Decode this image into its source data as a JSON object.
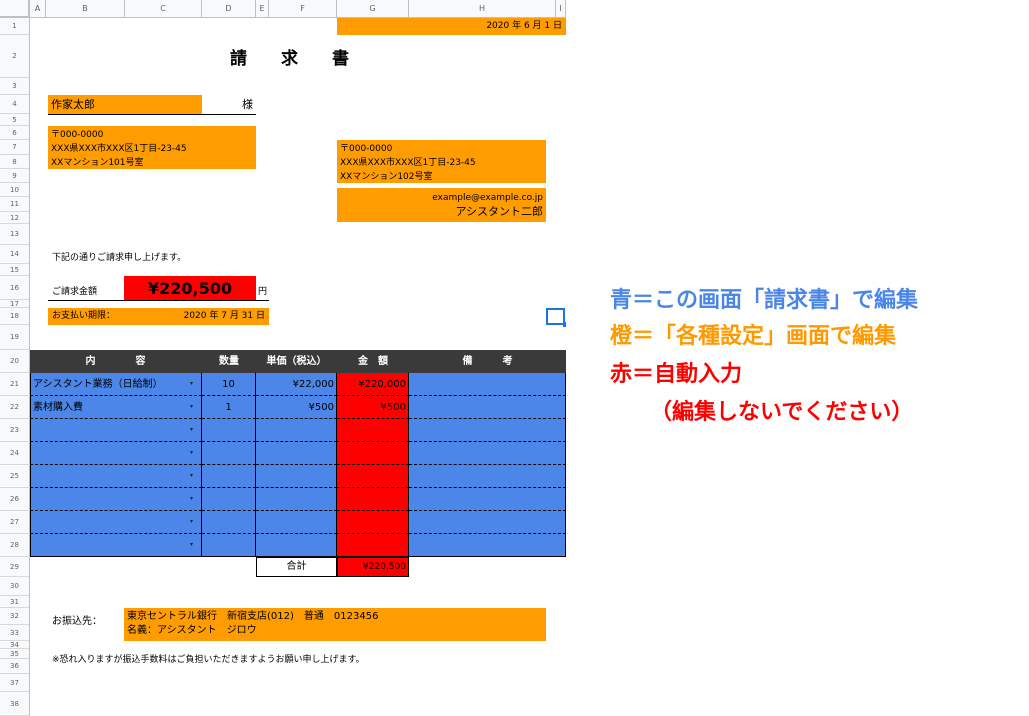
{
  "columns": [
    "A",
    "B",
    "C",
    "D",
    "E",
    "F",
    "G",
    "H",
    "I"
  ],
  "rows": [
    "1",
    "2",
    "3",
    "4",
    "5",
    "6",
    "7",
    "8",
    "9",
    "10",
    "11",
    "12",
    "13",
    "14",
    "15",
    "16",
    "17",
    "18",
    "19",
    "20",
    "21",
    "22",
    "23",
    "24",
    "25",
    "26",
    "27",
    "28",
    "29",
    "30",
    "31",
    "32",
    "33",
    "34",
    "35",
    "36",
    "37",
    "38"
  ],
  "date": "2020 年 6 月 1 日",
  "title": "請　　求　　書",
  "client": {
    "name": "作家太郎",
    "honorific": "様",
    "address": [
      "〒000-0000",
      "XXX県XXX市XXX区1丁目-23-45",
      "XXマンション101号室"
    ]
  },
  "sender": {
    "address": [
      "〒000-0000",
      "XXX県XXX市XXX区1丁目-23-45",
      "XXマンション102号室"
    ],
    "email": "example@example.co.jp",
    "name": "アシスタント二郎"
  },
  "intro": "下記の通りご請求申し上げます。",
  "amount_label": "ご請求金額",
  "amount": "¥220,500",
  "yen": "円",
  "due_label": "お支払い期限：",
  "due_date": "2020 年 7 月 31 日",
  "table": {
    "headers": [
      "内　　　　容",
      "数量",
      "単価（税込）",
      "金　額",
      "備　　　考"
    ],
    "items": [
      {
        "desc": "アシスタント業務（日給制）",
        "qty": "10",
        "price": "¥22,000",
        "amount": "¥220,000"
      },
      {
        "desc": "素材購入費",
        "qty": "1",
        "price": "¥500",
        "amount": "¥500"
      }
    ],
    "dropdown_symbol": "▾",
    "total_label": "合計",
    "total": "¥220,500"
  },
  "bank": {
    "label": "お振込先：",
    "line1": "東京セントラル銀行　新宿支店(012)　普通　0123456",
    "line2": "名義：アシスタント　ジロウ"
  },
  "note": "※恐れ入りますが振込手数料はご負担いただきますようお願い申し上げます。",
  "legend": {
    "blue": "青＝この画面「請求書」で編集",
    "orange": "橙＝「各種設定」画面で編集",
    "red": "赤＝自動入力",
    "red_sub": "（編集しないでください）",
    "blue_color": "#4a86e8",
    "orange_color": "#ff9900",
    "red_color": "#ff0000"
  }
}
